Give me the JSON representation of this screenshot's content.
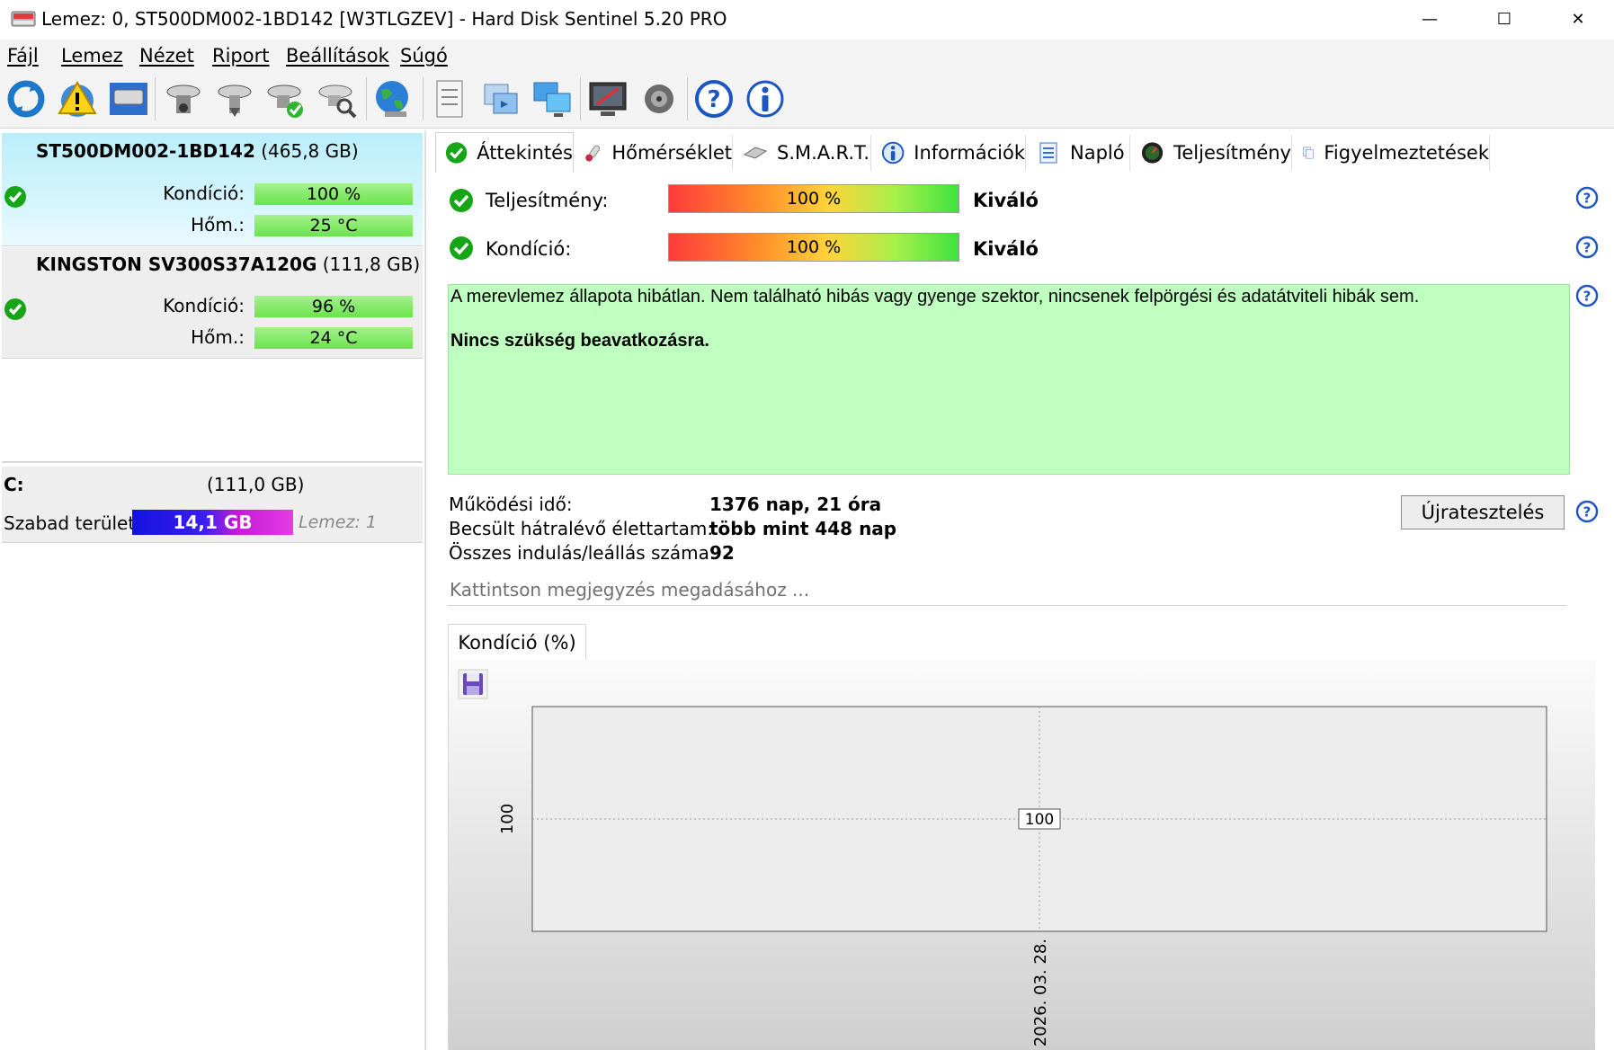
{
  "window": {
    "title": "Lemez: 0, ST500DM002-1BD142 [W3TLGZEV]  -  Hard Disk Sentinel 5.20 PRO",
    "minimize": "—",
    "maximize": "☐",
    "close": "✕"
  },
  "menu": [
    "Fájl",
    "Lemez",
    "Nézet",
    "Riport",
    "Beállítások",
    "Súgó"
  ],
  "toolbar_icons": [
    "refresh-icon",
    "alert-icon",
    "disk-icon",
    "disk-test-icon",
    "disk-surface-icon",
    "disk-check-icon",
    "disk-search-icon",
    "globe-icon",
    "report-icon",
    "sync-icon",
    "network-icon",
    "monitor-icon",
    "speaker-icon",
    "help-icon",
    "info-icon"
  ],
  "disks": [
    {
      "name": "ST500DM002-1BD142",
      "size": "(465,8 GB)",
      "cond_label": "Kondíció:",
      "cond": "100 %",
      "temp_label": "Hőm.:",
      "temp": "25 °C"
    },
    {
      "name": "KINGSTON SV300S37A120G",
      "size": "(111,8 GB)",
      "cond_label": "Kondíció:",
      "cond": "96 %",
      "temp_label": "Hőm.:",
      "temp": "24 °C"
    }
  ],
  "volume": {
    "letter": "C:",
    "size": "(111,0 GB)",
    "free_label": "Szabad terület",
    "free": "14,1 GB",
    "disk": "Lemez: 1"
  },
  "tabs": [
    "Áttekintés",
    "Hőmérséklet",
    "S.M.A.R.T.",
    "Információk",
    "Napló",
    "Teljesítmény",
    "Figyelmeztetések"
  ],
  "overview": {
    "perf_label": "Teljesítmény:",
    "perf_value": "100 %",
    "perf_rating": "Kiváló",
    "cond_label": "Kondíció:",
    "cond_value": "100 %",
    "cond_rating": "Kiváló",
    "status_text": "A merevlemez állapota hibátlan. Nem található hibás vagy gyenge szektor, nincsenek felpörgési és adatátviteli hibák sem.",
    "status_action": "Nincs szükség beavatkozásra.",
    "uptime_label": "Működési idő:",
    "uptime": "1376 nap, 21 óra",
    "remaining_label": "Becsült hátralévő élettartam:",
    "remaining": "több mint 448 nap",
    "startstop_label": "Összes indulás/leállás száma:",
    "startstop": "92",
    "retest_button": "Újratesztelés",
    "note_placeholder": "Kattintson megjegyzés megadásához ..."
  },
  "graph_tab": "Kondíció  (%)",
  "chart_data": {
    "type": "line",
    "x": [
      "2026. 03. 28."
    ],
    "series": [
      {
        "values": [
          100
        ]
      }
    ],
    "ylabel_tick": "100",
    "data_label": "100",
    "grid": true
  }
}
